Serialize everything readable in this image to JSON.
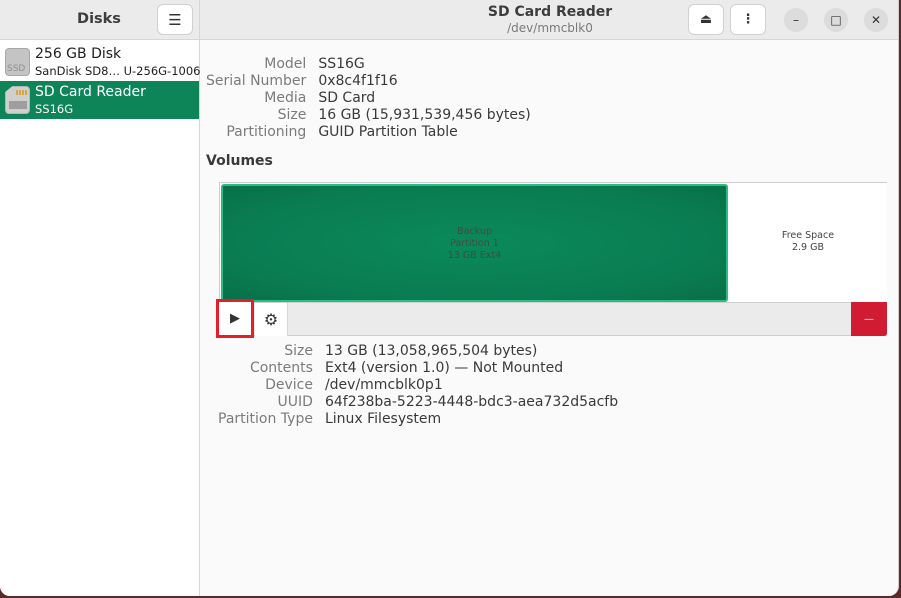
{
  "sidebar": {
    "title": "Disks",
    "menu_icon": "hamburger-menu-icon",
    "disks": [
      {
        "name": "256 GB Disk",
        "subtitle": "SanDisk SD8…  U-256G-1006",
        "icon": "ssd-icon",
        "icon_label": "SSD",
        "selected": false
      },
      {
        "name": "SD Card Reader",
        "subtitle": "SS16G",
        "icon": "sd-card-icon",
        "selected": true
      }
    ]
  },
  "header": {
    "title": "SD Card Reader",
    "subtitle": "/dev/mmcblk0",
    "eject_icon": "⏏",
    "more_icon": "⋮",
    "minimize_icon": "–",
    "maximize_icon": "□",
    "close_icon": "✕"
  },
  "drive_info": [
    {
      "label": "Model",
      "value": "SS16G"
    },
    {
      "label": "Serial Number",
      "value": "0x8c4f1f16"
    },
    {
      "label": "Media",
      "value": "SD Card"
    },
    {
      "label": "Size",
      "value": "16 GB (15,931,539,456 bytes)"
    },
    {
      "label": "Partitioning",
      "value": "GUID Partition Table"
    }
  ],
  "volumes": {
    "title": "Volumes",
    "partition": {
      "line1": "Backup",
      "line2": "Partition 1",
      "line3": "13 GB Ext4",
      "fraction_of_disk": 0.82
    },
    "free_space": {
      "line1": "Free Space",
      "line2": "2.9 GB"
    },
    "toolbar": {
      "play_icon": "▶",
      "gear_icon": "⚙",
      "delete_icon": "—"
    },
    "colors": {
      "partition": "#0a8a5a",
      "delete": "#d01b32",
      "highlight": "#e3202a"
    }
  },
  "volume_info": [
    {
      "label": "Size",
      "value": "13 GB (13,058,965,504 bytes)"
    },
    {
      "label": "Contents",
      "value": "Ext4 (version 1.0) — Not Mounted"
    },
    {
      "label": "Device",
      "value": "/dev/mmcblk0p1"
    },
    {
      "label": "UUID",
      "value": "64f238ba-5223-4448-bdc3-aea732d5acfb"
    },
    {
      "label": "Partition Type",
      "value": "Linux Filesystem"
    }
  ]
}
